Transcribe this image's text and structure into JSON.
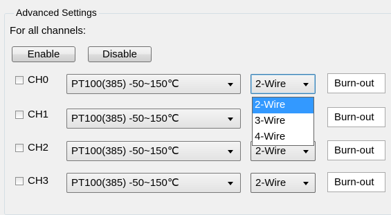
{
  "group": {
    "title": "Advanced Settings"
  },
  "for_all_label": "For all channels:",
  "buttons": {
    "enable": "Enable",
    "disable": "Disable"
  },
  "channels": [
    {
      "label": "CH0",
      "checked": false,
      "sensor": "PT100(385) -50~150℃",
      "wire": "2-Wire",
      "burnout": "Burn-out"
    },
    {
      "label": "CH1",
      "checked": false,
      "sensor": "PT100(385) -50~150℃",
      "wire": "",
      "burnout": "Burn-out"
    },
    {
      "label": "CH2",
      "checked": false,
      "sensor": "PT100(385) -50~150℃",
      "wire": "2-Wire",
      "burnout": "Burn-out"
    },
    {
      "label": "CH3",
      "checked": false,
      "sensor": "PT100(385) -50~150℃",
      "wire": "2-Wire",
      "burnout": "Burn-out"
    }
  ],
  "wire_dropdown": {
    "open": true,
    "options": [
      "2-Wire",
      "3-Wire",
      "4-Wire"
    ],
    "selected": "2-Wire"
  },
  "colors": {
    "selection": "#3399ff",
    "focus_border": "#3c7fb1"
  }
}
